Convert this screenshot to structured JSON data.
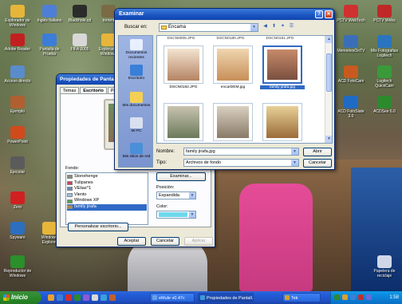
{
  "desktop_icons": [
    {
      "label": "Explorador de Windows",
      "color": "#e7b53a",
      "icon": "folder-explorer-icon"
    },
    {
      "label": "Inglés Italiano",
      "color": "#4d7fd6",
      "icon": "app-icon"
    },
    {
      "label": "Blackhole.cd",
      "color": "#2b2b2b",
      "icon": "disc-icon"
    },
    {
      "label": "torrent",
      "color": "#7a6b45",
      "icon": "torrent-icon"
    },
    {
      "label": "Adobe Reader",
      "color": "#c22020",
      "icon": "pdf-icon"
    },
    {
      "label": "Pantalla de Prueba",
      "color": "#3c7dd8",
      "icon": "monitor-icon"
    },
    {
      "label": "FIFA 2005",
      "color": "#d8d8d8",
      "icon": "game-icon"
    },
    {
      "label": "Explorador Windows",
      "color": "#e7b53a",
      "icon": "folder-icon"
    },
    {
      "label": "Acceso directo",
      "color": "#5a8ccc",
      "icon": "shortcut-icon"
    },
    {
      "label": "Ejemplo",
      "color": "#b06030",
      "icon": "app-icon"
    },
    {
      "label": "PowerPoint",
      "color": "#d04a1c",
      "icon": "powerpoint-icon"
    },
    {
      "label": "Ejecutar",
      "color": "#5b5b5b",
      "icon": "app-icon"
    },
    {
      "label": "Zero",
      "color": "#d02020",
      "icon": "app-icon"
    },
    {
      "label": "Spyware",
      "color": "#2c6fc0",
      "icon": "shield-icon"
    },
    {
      "label": "Windows Explorer",
      "color": "#e7b53a",
      "icon": "folder-icon"
    },
    {
      "label": "Reproductor de Windows",
      "color": "#2b8f2b",
      "icon": "media-icon"
    },
    {
      "label": "PCTV WebTech",
      "color": "#d03030",
      "icon": "tv-icon"
    },
    {
      "label": "PCTV Webs",
      "color": "#c02828",
      "icon": "tv-icon"
    },
    {
      "label": "MemoriesOnTV",
      "color": "#3a6fb8",
      "icon": "memories-icon"
    },
    {
      "label": "Mis Fotografias Logitech",
      "color": "#2a74c0",
      "icon": "photos-icon"
    },
    {
      "label": "ACD FotoCam",
      "color": "#c85a20",
      "icon": "camera-icon"
    },
    {
      "label": "Logitech QuickCam",
      "color": "#3a9a3a",
      "icon": "webcam-icon"
    },
    {
      "label": "ACD FotoSlate 3.0",
      "color": "#1f6bc4",
      "icon": "slate-icon"
    },
    {
      "label": "ACDSee 6.0",
      "color": "#2c8a2c",
      "icon": "acdsee-icon"
    },
    {
      "label": "Papelera de reciclaje",
      "color": "#d0d8e8",
      "icon": "recycle-bin-icon"
    }
  ],
  "properties_dialog": {
    "title": "Propiedades de Pantalla",
    "tabs": [
      "Temas",
      "Escritorio",
      "Protecto"
    ],
    "fondo_label": "Fondo:",
    "fondo_items": [
      {
        "label": "Stonehenge",
        "color": "#8a8a7a"
      },
      {
        "label": "Tulipanes",
        "color": "#d04060"
      },
      {
        "label": "VElias^1",
        "color": "#6a8ab0"
      },
      {
        "label": "Viento",
        "color": "#9ac0e0"
      },
      {
        "label": "Windows XP",
        "color": "#5aa050"
      },
      {
        "label": "family jirafa",
        "color": "#b08a50"
      }
    ],
    "examinar_button": "Examinar...",
    "position_label": "Posición:",
    "position_value": "Expandida",
    "color_label": "Color:",
    "color_value": "#6fd8ec",
    "customize_button": "Personalizar escritorio...",
    "ok_button": "Aceptar",
    "cancel_button": "Cancelar",
    "apply_button": "Aplicar"
  },
  "browse_dialog": {
    "title": "Examinar",
    "lookin_label": "Buscar en:",
    "lookin_value": "Encama",
    "places": [
      {
        "label": "Documentos recientes",
        "color": "#e8f0ff",
        "icon": "recent-documents-icon"
      },
      {
        "label": "Escritorio",
        "color": "#3a7fd8",
        "icon": "desktop-icon"
      },
      {
        "label": "Mis documentos",
        "color": "#f4cf54",
        "icon": "my-documents-icon"
      },
      {
        "label": "Mi PC",
        "color": "#d8e0f0",
        "icon": "my-computer-icon"
      },
      {
        "label": "Mis sitios de red",
        "color": "#4a8fd8",
        "icon": "network-places-icon"
      }
    ],
    "header_files": [
      "DSCN0005.JPG",
      "DSCN0180.JPG",
      "DSCN0181.JPG"
    ],
    "thumbnails": [
      {
        "label": "DSCN0182.JPG",
        "c1": "#f3e4d0",
        "c2": "#b58363",
        "selected": false
      },
      {
        "label": "encarDEM.jpg",
        "c1": "#f0d6b0",
        "c2": "#c88f58",
        "selected": false
      },
      {
        "label": "family jirafa.jpg",
        "c1": "#c78a6a",
        "c2": "#7a5040",
        "selected": true
      },
      {
        "label": "",
        "c1": "#c8c3b0",
        "c2": "#6b7a5a",
        "selected": false
      },
      {
        "label": "",
        "c1": "#d8d0c0",
        "c2": "#8a7a68",
        "selected": false
      },
      {
        "label": "",
        "c1": "#e8d098",
        "c2": "#9a6b38",
        "selected": false
      }
    ],
    "filename_label": "Nombre:",
    "filename_value": "family jirafa.jpg",
    "filetype_label": "Tipo:",
    "filetype_value": "Archivos de fondo",
    "open_button": "Abrir",
    "cancel_button": "Cancelar"
  },
  "taskbar": {
    "start_label": "Inicio",
    "tasks": [
      {
        "label": "eMule v0.47c",
        "color": "#6aa0e8"
      },
      {
        "label": "Propiedades de Pantall...",
        "color": "#3a9ad8"
      },
      {
        "label": "Tek",
        "color": "#d8a030"
      }
    ],
    "clock": "1:58"
  }
}
